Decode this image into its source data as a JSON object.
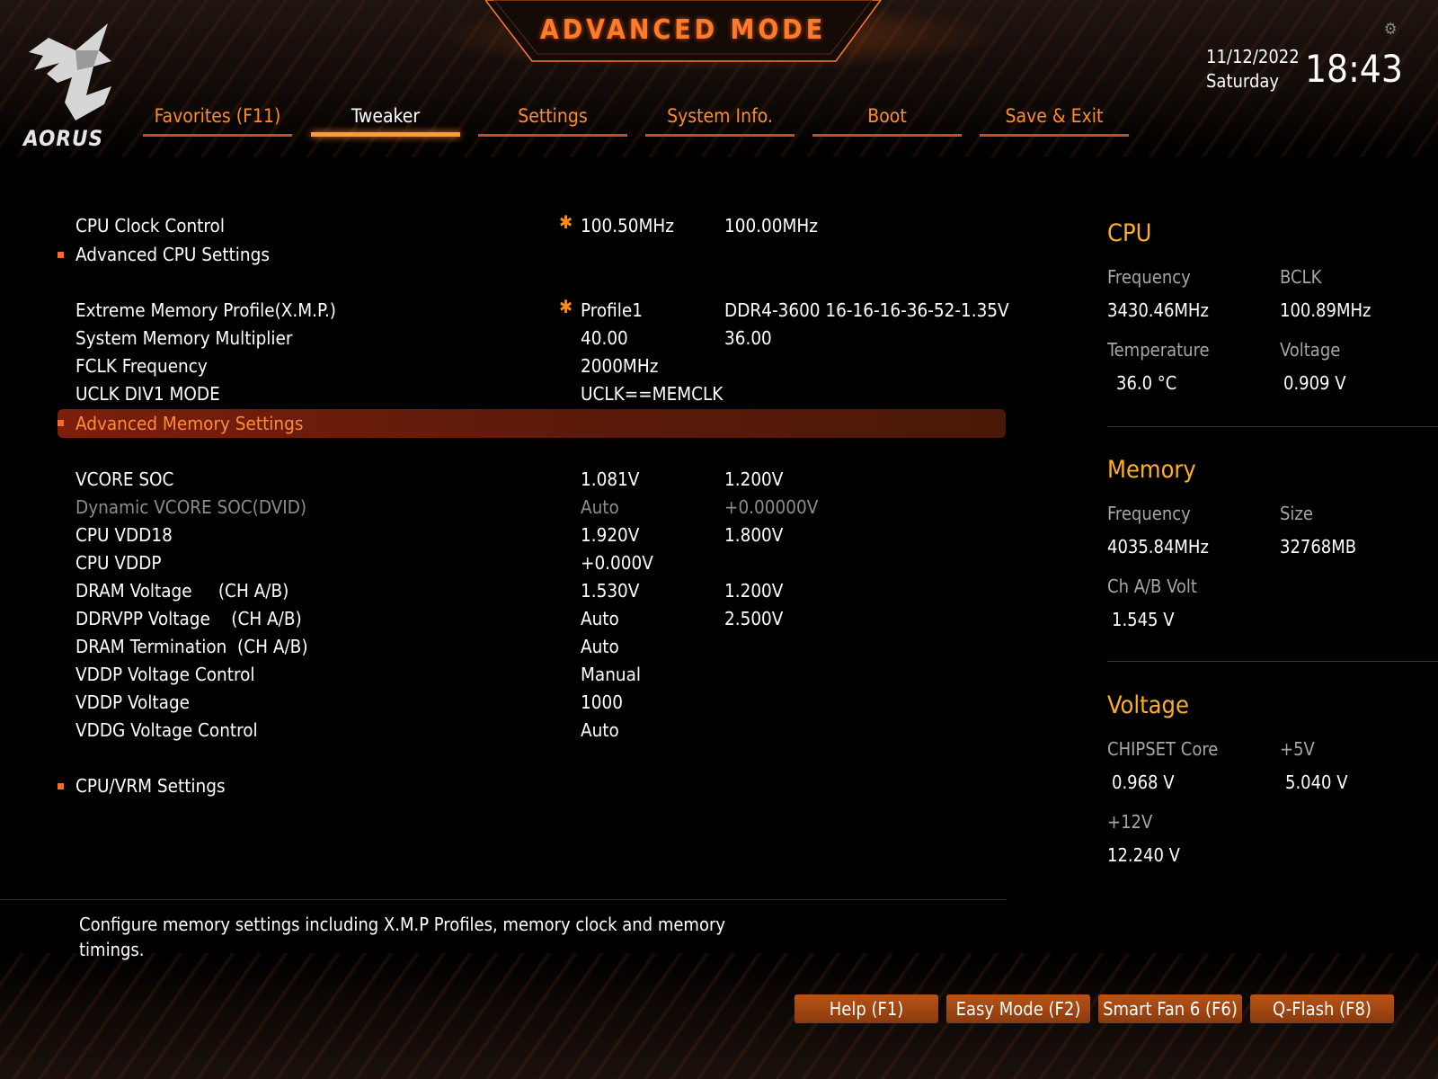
{
  "header": {
    "title": "ADVANCED MODE",
    "date": "11/12/2022",
    "weekday": "Saturday",
    "time": "18:43",
    "brand": "AORUS"
  },
  "tabs": [
    {
      "label": "Favorites (F11)",
      "active": false
    },
    {
      "label": "Tweaker",
      "active": true
    },
    {
      "label": "Settings",
      "active": false
    },
    {
      "label": "System Info.",
      "active": false
    },
    {
      "label": "Boot",
      "active": false
    },
    {
      "label": "Save & Exit",
      "active": false
    }
  ],
  "settings": {
    "cpu_clock": {
      "label": "CPU Clock Control",
      "v1": "100.50MHz",
      "v2": "100.00MHz"
    },
    "adv_cpu": {
      "label": "Advanced CPU Settings"
    },
    "xmp": {
      "label": "Extreme Memory Profile(X.M.P.)",
      "v1": "Profile1",
      "v2": "DDR4-3600 16-16-16-36-52-1.35V"
    },
    "mem_mult": {
      "label": "System Memory Multiplier",
      "v1": "40.00",
      "v2": "36.00"
    },
    "fclk": {
      "label": "FCLK Frequency",
      "v1": "2000MHz"
    },
    "uclk": {
      "label": "UCLK DIV1 MODE",
      "v1": "UCLK==MEMCLK"
    },
    "adv_mem": {
      "label": "Advanced Memory Settings"
    },
    "vcore_soc": {
      "label": "VCORE SOC",
      "v1": "1.081V",
      "v2": "1.200V"
    },
    "dyn_vcore": {
      "label": "Dynamic VCORE SOC(DVID)",
      "v1": "Auto",
      "v2": "+0.00000V"
    },
    "vdd18": {
      "label": "CPU VDD18",
      "v1": "1.920V",
      "v2": "1.800V"
    },
    "vddp": {
      "label": "CPU VDDP",
      "v1": "+0.000V"
    },
    "dram_v": {
      "label": "DRAM Voltage     (CH A/B)",
      "v1": "1.530V",
      "v2": "1.200V"
    },
    "ddrvpp": {
      "label": "DDRVPP Voltage    (CH A/B)",
      "v1": "Auto",
      "v2": "2.500V"
    },
    "dram_term": {
      "label": "DRAM Termination  (CH A/B)",
      "v1": "Auto"
    },
    "vddp_ctrl": {
      "label": "VDDP Voltage Control",
      "v1": "Manual"
    },
    "vddp_v": {
      "label": "VDDP Voltage",
      "v1": "1000"
    },
    "vddg_ctrl": {
      "label": "VDDG Voltage Control",
      "v1": "Auto"
    },
    "cpu_vrm": {
      "label": "CPU/VRM Settings"
    }
  },
  "panel": {
    "cpu": {
      "title": "CPU",
      "freq_label": "Frequency",
      "freq": "3430.46MHz",
      "bclk_label": "BCLK",
      "bclk": "100.89MHz",
      "temp_label": "Temperature",
      "temp": "36.0 °C",
      "volt_label": "Voltage",
      "volt": "0.909 V"
    },
    "memory": {
      "title": "Memory",
      "freq_label": "Frequency",
      "freq": "4035.84MHz",
      "size_label": "Size",
      "size": "32768MB",
      "chvolt_label": "Ch A/B Volt",
      "chvolt": "1.545 V"
    },
    "voltage": {
      "title": "Voltage",
      "chipset_label": "CHIPSET Core",
      "chipset": "0.968 V",
      "p5v_label": "+5V",
      "p5v": "5.040 V",
      "p12v_label": "+12V",
      "p12v": "12.240 V"
    }
  },
  "help_text": "Configure memory settings including X.M.P Profiles, memory clock and memory timings.",
  "footer_buttons": {
    "help": "Help (F1)",
    "easy": "Easy Mode (F2)",
    "fan": "Smart Fan 6 (F6)",
    "qflash": "Q-Flash (F8)"
  },
  "colors": {
    "accent": "#ff7a2a",
    "panel_title": "#ffb020",
    "selected_row": "#7a1f0c"
  }
}
